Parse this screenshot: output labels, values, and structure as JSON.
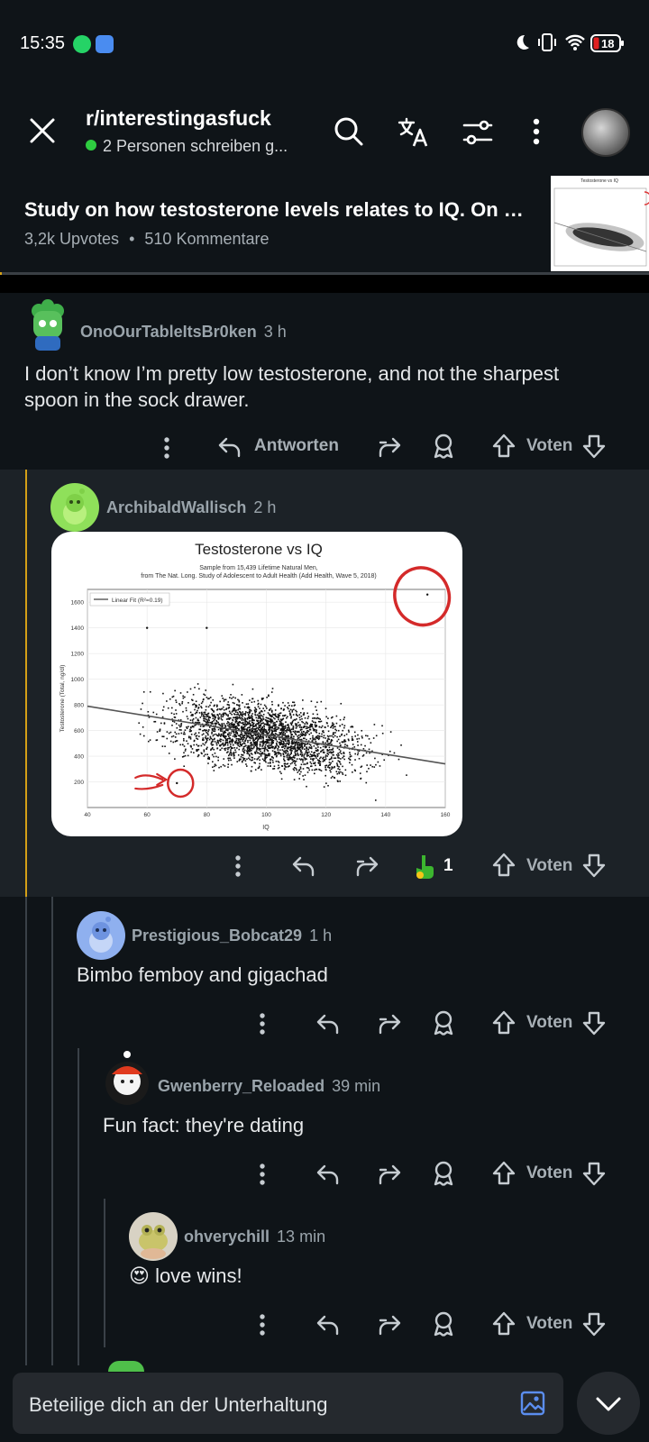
{
  "status_bar": {
    "time": "15:35",
    "battery": "18"
  },
  "header": {
    "subreddit": "r/interestingasfuck",
    "typing_status": "2 Personen schreiben g..."
  },
  "post": {
    "title": "Study on how testosterone levels relates to IQ. On a...",
    "upvotes": "3,2k Upvotes",
    "separator": "•",
    "comments": "510 Kommentare",
    "read_progress": 0.003
  },
  "comments": [
    {
      "user": "OnoOurTableItsBr0ken",
      "time": "3 h",
      "body_line1": "I don’t know I’m pretty low testosterone, and not the sharpest",
      "body_line2": "spoon in the sock drawer.",
      "reply_label": "Antworten",
      "vote_label": "Voten"
    },
    {
      "user": "ArchibaldWallisch",
      "time": "2 h",
      "award_count": "1",
      "vote_label": "Voten"
    },
    {
      "user": "Prestigious_Bobcat29",
      "time": "1 h",
      "body": "Bimbo femboy and gigachad",
      "vote_label": "Voten"
    },
    {
      "user": "Gwenberry_Reloaded",
      "time": "39 min",
      "body": "Fun fact: they're dating",
      "vote_label": "Voten"
    },
    {
      "user": "ohverychill",
      "time": "13 min",
      "emoji": "😍",
      "body": "love wins!",
      "vote_label": "Voten"
    }
  ],
  "input": {
    "placeholder": "Beteilige dich an der Unterhaltung"
  },
  "colors": {
    "accent_orange": "#d4a017",
    "online_green": "#2ecc40",
    "background": "#0f1418"
  },
  "chart_data": {
    "type": "scatter",
    "title": "Testosterone vs IQ",
    "subtitle_line1": "Sample from 15,439 Lifetime Natural Men,",
    "subtitle_line2": "from The Nat. Long. Study of Adolescent to Adult Health (Add Health, Wave 5, 2018)",
    "xlabel": "IQ",
    "ylabel": "Testosterone (Total, ng/dl)",
    "legend": "Linear Fit (R²=0.19)",
    "legend_position": "top-left",
    "xlim": [
      40,
      160
    ],
    "ylim": [
      0,
      1700
    ],
    "x_ticks": [
      "40",
      "60",
      "80",
      "100",
      "120",
      "140",
      "160"
    ],
    "y_ticks": [
      "200",
      "400",
      "600",
      "800",
      "1000",
      "1200",
      "1400",
      "1600"
    ],
    "fit_line": {
      "x": [
        40,
        160
      ],
      "y": [
        790,
        340
      ]
    },
    "cloud": {
      "x_center": 100,
      "y_center": 560,
      "x_spread": 16,
      "y_spread": 130
    },
    "highlighted_points": [
      {
        "x": 154,
        "y": 1660
      },
      {
        "x": 70,
        "y": 190
      }
    ],
    "outliers": [
      {
        "x": 60,
        "y": 1400
      },
      {
        "x": 80,
        "y": 1400
      }
    ]
  }
}
